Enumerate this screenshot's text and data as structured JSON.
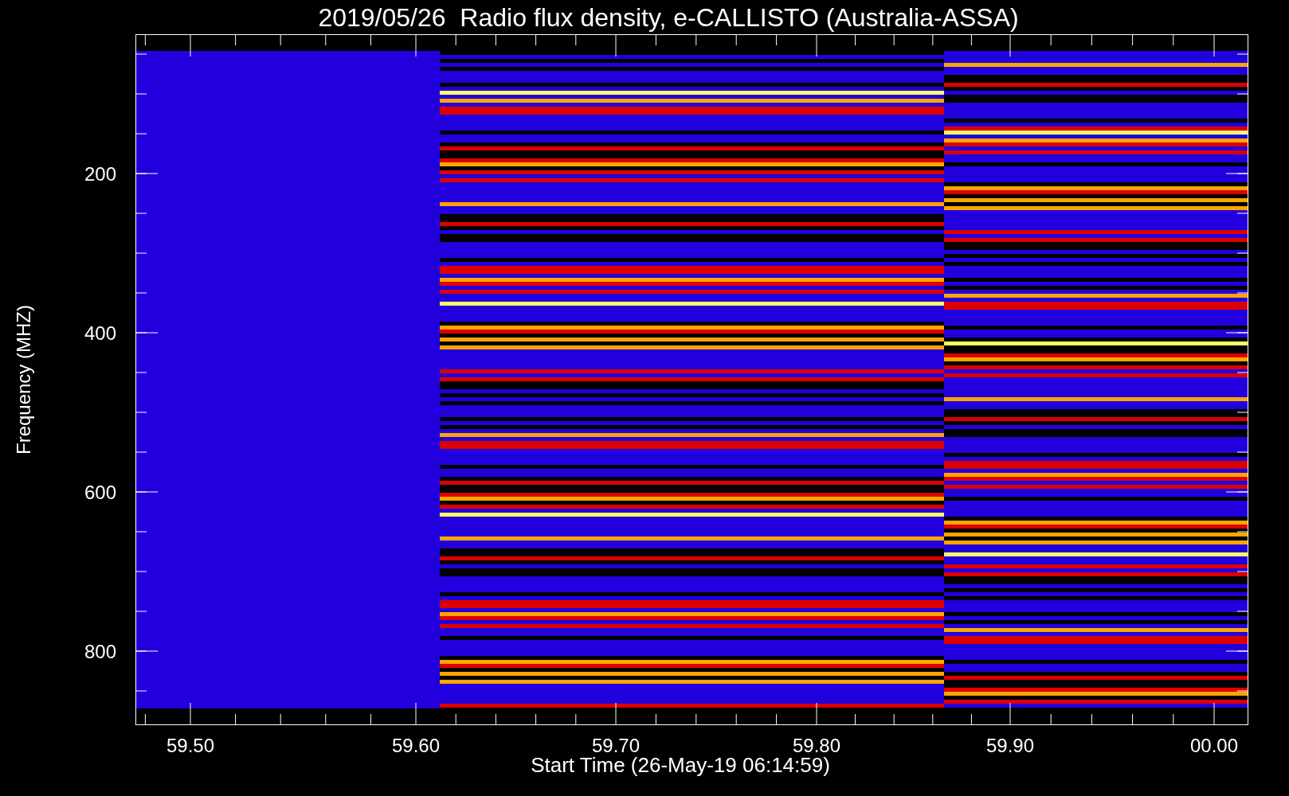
{
  "title": "2019/05/26  Radio flux density, e-CALLISTO (Australia-ASSA)",
  "y_axis": {
    "title": "Frequency (MHZ)",
    "ticks": [
      "200",
      "400",
      "600",
      "800"
    ]
  },
  "x_axis": {
    "title": "Start Time (26-May-19 06:14:59)",
    "ticks": [
      "59.50",
      "59.60",
      "59.70",
      "59.80",
      "59.90",
      "00.00"
    ]
  }
}
